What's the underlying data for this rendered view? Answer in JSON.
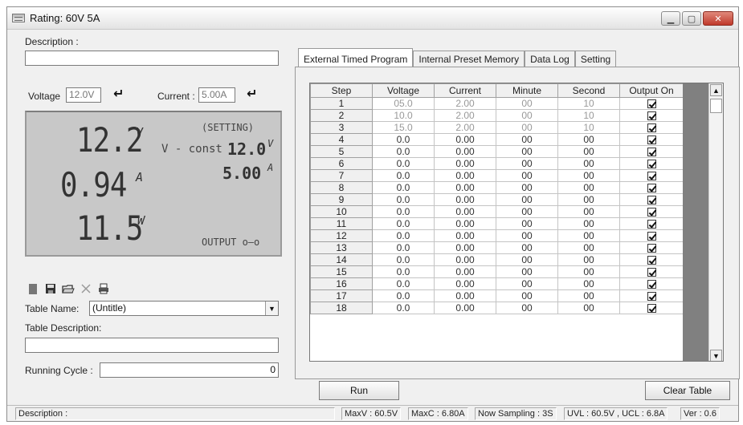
{
  "window": {
    "title": "Rating: 60V 5A",
    "controls": [
      "minimize",
      "maximize",
      "close"
    ]
  },
  "left": {
    "description_label": "Description :",
    "description_value": "",
    "voltage_label": "Voltage",
    "voltage_value": "12.0V",
    "current_label": "Current :",
    "current_value": "5.00A",
    "display": {
      "voltage": "12.2",
      "voltage_unit": "V",
      "current": "0.94",
      "current_unit": "A",
      "power": "11.5",
      "power_unit": "W",
      "setting_label": "(SETTING)",
      "mode_label": "V - const",
      "set_voltage": "12.0",
      "set_voltage_unit": "V",
      "set_current": "5.00",
      "set_current_unit": "A",
      "output_label": "OUTPUT o—o"
    },
    "toolbar_icons": [
      "new-icon",
      "save-icon",
      "open-icon",
      "delete-icon",
      "print-icon"
    ],
    "table_name_label": "Table Name:",
    "table_name_value": "(Untitle)",
    "table_description_label": "Table Description:",
    "table_description_value": "",
    "running_cycle_label": "Running Cycle :",
    "running_cycle_value": "0"
  },
  "tabs": [
    {
      "label": "External Timed Program",
      "active": true
    },
    {
      "label": "Internal Preset Memory",
      "active": false
    },
    {
      "label": "Data Log",
      "active": false
    },
    {
      "label": "Setting",
      "active": false
    }
  ],
  "table": {
    "columns": [
      "Step",
      "Voltage",
      "Current",
      "Minute",
      "Second",
      "Output On"
    ],
    "rows": [
      [
        "1",
        "05.0",
        "2.00",
        "00",
        "10",
        true
      ],
      [
        "2",
        "10.0",
        "2.00",
        "00",
        "10",
        true
      ],
      [
        "3",
        "15.0",
        "2.00",
        "00",
        "10",
        true
      ],
      [
        "4",
        "0.0",
        "0.00",
        "00",
        "00",
        true
      ],
      [
        "5",
        "0.0",
        "0.00",
        "00",
        "00",
        true
      ],
      [
        "6",
        "0.0",
        "0.00",
        "00",
        "00",
        true
      ],
      [
        "7",
        "0.0",
        "0.00",
        "00",
        "00",
        true
      ],
      [
        "8",
        "0.0",
        "0.00",
        "00",
        "00",
        true
      ],
      [
        "9",
        "0.0",
        "0.00",
        "00",
        "00",
        true
      ],
      [
        "10",
        "0.0",
        "0.00",
        "00",
        "00",
        true
      ],
      [
        "11",
        "0.0",
        "0.00",
        "00",
        "00",
        true
      ],
      [
        "12",
        "0.0",
        "0.00",
        "00",
        "00",
        true
      ],
      [
        "13",
        "0.0",
        "0.00",
        "00",
        "00",
        true
      ],
      [
        "14",
        "0.0",
        "0.00",
        "00",
        "00",
        true
      ],
      [
        "15",
        "0.0",
        "0.00",
        "00",
        "00",
        true
      ],
      [
        "16",
        "0.0",
        "0.00",
        "00",
        "00",
        true
      ],
      [
        "17",
        "0.0",
        "0.00",
        "00",
        "00",
        true
      ],
      [
        "18",
        "0.0",
        "0.00",
        "00",
        "00",
        true
      ]
    ]
  },
  "buttons": {
    "run": "Run",
    "clear_table": "Clear Table"
  },
  "status": {
    "description": "Description :",
    "maxv": "MaxV : 60.5V",
    "maxc": "MaxC : 6.80A",
    "sampling": "Now Sampling : 3S",
    "limits": "UVL : 60.5V , UCL : 6.8A",
    "version": "Ver : 0.6"
  }
}
